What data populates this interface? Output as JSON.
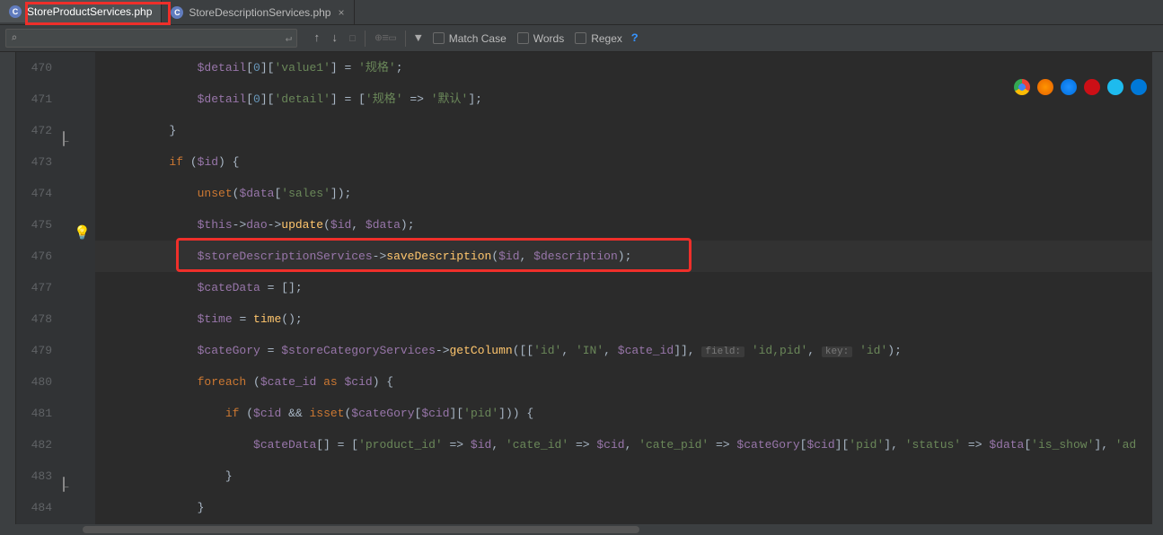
{
  "tabs": [
    {
      "icon": "C",
      "label": "StoreProductServices.php",
      "closable": false,
      "active": true
    },
    {
      "icon": "C",
      "label": "StoreDescriptionServices.php",
      "closable": true,
      "active": false
    }
  ],
  "search": {
    "placeholder": "Q",
    "options": {
      "matchcase": "Match Case",
      "words": "Words",
      "regex": "Regex"
    }
  },
  "gutter": [
    "470",
    "471",
    "472",
    "473",
    "474",
    "475",
    "476",
    "477",
    "478",
    "479",
    "480",
    "481",
    "482",
    "483",
    "484"
  ],
  "code": {
    "l470": {
      "pre": "            ",
      "v1": "$detail",
      "v2": "[",
      "v3": "0",
      "v4": "][",
      "v5": "'value1'",
      "v6": "] = ",
      "v7": "'规格'",
      "v8": ";"
    },
    "l471": {
      "pre": "            ",
      "v1": "$detail",
      "v2": "[",
      "v3": "0",
      "v4": "][",
      "v5": "'detail'",
      "v6": "] = [",
      "v7": "'规格'",
      "v8": " => ",
      "v9": "'默认'",
      "v10": "];"
    },
    "l472": {
      "pre": "        ",
      "v1": "}"
    },
    "l473": {
      "pre": "        ",
      "v1": "if ",
      "v2": "(",
      "v3": "$id",
      "v4": ") {"
    },
    "l474": {
      "pre": "            ",
      "v1": "unset",
      "v2": "(",
      "v3": "$data",
      "v4": "[",
      "v5": "'sales'",
      "v6": "]);"
    },
    "l475": {
      "pre": "            ",
      "v1": "$this",
      "v2": "->",
      "v3": "dao",
      "v4": "->",
      "v5": "update",
      "v6": "(",
      "v7": "$id",
      "v8": ", ",
      "v9": "$data",
      "v10": ");"
    },
    "l476": {
      "pre": "            ",
      "v1": "$storeDescriptionServices",
      "v2": "->",
      "v3": "saveDescription",
      "v4": "(",
      "v5": "$id",
      "v6": ", ",
      "v7": "$description",
      "v8": ");"
    },
    "l477": {
      "pre": "            ",
      "v1": "$cateData ",
      "v2": "= [];"
    },
    "l478": {
      "pre": "            ",
      "v1": "$time ",
      "v2": "= ",
      "v3": "time",
      "v4": "();"
    },
    "l479": {
      "pre": "            ",
      "v1": "$cateGory ",
      "v2": "= ",
      "v3": "$storeCategoryServices",
      "v4": "->",
      "v5": "getColumn",
      "v6": "([[",
      "v7": "'id'",
      "v8": ", ",
      "v9": "'IN'",
      "v10": ", ",
      "v11": "$cate_id",
      "v12": "]], ",
      "h1": "field:",
      "v13": " 'id,pid'",
      "v14": ", ",
      "h2": "key:",
      "v15": " 'id'",
      "v16": ");"
    },
    "l480": {
      "pre": "            ",
      "v1": "foreach ",
      "v2": "(",
      "v3": "$cate_id ",
      "v4": "as ",
      "v5": "$cid",
      "v6": ") {"
    },
    "l481": {
      "pre": "                ",
      "v1": "if ",
      "v2": "(",
      "v3": "$cid ",
      "v4": "&& ",
      "v5": "isset",
      "v6": "(",
      "v7": "$cateGory",
      "v8": "[",
      "v9": "$cid",
      "v10": "][",
      "v11": "'pid'",
      "v12": "])) {"
    },
    "l482": {
      "pre": "                    ",
      "v1": "$cateData",
      "v2": "[] = [",
      "v3": "'product_id'",
      "v4": " => ",
      "v5": "$id",
      "v6": ", ",
      "v7": "'cate_id'",
      "v8": " => ",
      "v9": "$cid",
      "v10": ", ",
      "v11": "'cate_pid'",
      "v12": " => ",
      "v13": "$cateGory",
      "v14": "[",
      "v15": "$cid",
      "v16": "][",
      "v17": "'pid'",
      "v18": "], ",
      "v19": "'status'",
      "v20": " => ",
      "v21": "$data",
      "v22": "[",
      "v23": "'is_show'",
      "v24": "], ",
      "v25": "'ad"
    },
    "l483": {
      "pre": "                ",
      "v1": "}"
    },
    "l484": {
      "pre": "            ",
      "v1": "}"
    }
  }
}
